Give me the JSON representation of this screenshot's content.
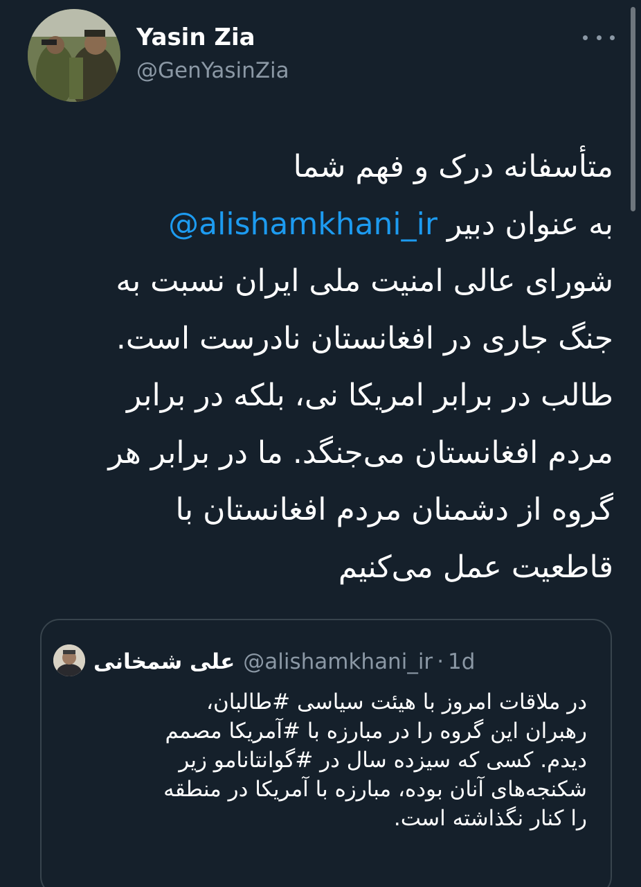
{
  "author": {
    "display_name": "Yasin Zia",
    "handle": "@GenYasinZia",
    "avatar_icon": "profile-photo"
  },
  "tweet": {
    "lines": [
      "متأسفانه درک و فهم شما",
      "به عنوان دبیر",
      "شورای عالی امنیت ملی ایران نسبت به",
      "جنگ جاری در افغانستان نادرست است.",
      "طالب در برابر امریکا نی، بلکه در برابر",
      "مردم افغانستان می‌جنگد. ما در برابر هر",
      "گروه از دشمنان مردم افغانستان با",
      "قاطعیت عمل می‌کنیم"
    ],
    "mention": "@alishamkhani_ir"
  },
  "quoted_tweet": {
    "display_name": "علی شمخانی",
    "handle": "@alishamkhani_ir",
    "separator": "·",
    "time": "1d",
    "lines": [
      "در ملاقات امروز با هیئت سیاسی #طالبان،",
      "رهبران این گروه را در مبارزه با #آمریکا مصمم",
      "دیدم. کسی که سیزده سال در #گوانتانامو زیر",
      "شکنجه‌های آنان بوده، مبارزه با آمریکا در منطقه",
      "را کنار نگذاشته است."
    ]
  },
  "colors": {
    "background": "#15202b",
    "text": "#ffffff",
    "secondary": "#8b98a5",
    "link": "#1d9bf0",
    "border": "#38444d"
  },
  "icons": {
    "more": "more-horizontal-icon"
  }
}
